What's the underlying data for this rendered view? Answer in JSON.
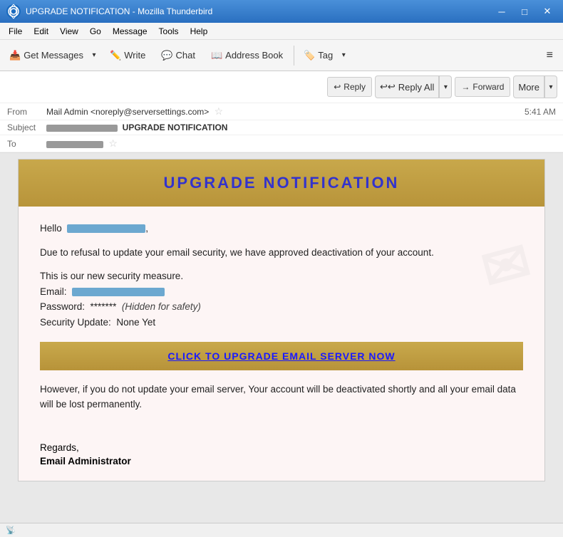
{
  "titleBar": {
    "title": "UPGRADE NOTIFICATION - Mozilla Thunderbird",
    "minimize": "─",
    "maximize": "□",
    "close": "✕"
  },
  "menuBar": {
    "items": [
      "File",
      "Edit",
      "View",
      "Go",
      "Message",
      "Tools",
      "Help"
    ]
  },
  "toolbar": {
    "getMessages": "Get Messages",
    "write": "Write",
    "chat": "Chat",
    "addressBook": "Address Book",
    "tag": "Tag",
    "hamburger": "≡"
  },
  "actionBar": {
    "reply": "Reply",
    "replyAll": "Reply All",
    "forward": "Forward",
    "more": "More"
  },
  "messageHeader": {
    "fromLabel": "From",
    "fromValue": "Mail Admin <noreply@serversettings.com>",
    "subjectLabel": "Subject",
    "subjectPrefix": "██████████████",
    "subjectText": "UPGRADE NOTIFICATION",
    "toLabel": "To",
    "toValue": "██████████",
    "time": "5:41 AM"
  },
  "emailContent": {
    "headerTitle": "UPGRADE  NOTIFICATION",
    "greeting": "Hello",
    "greetingComma": ",",
    "body1": "Due to refusal to update your email security, we have approved deactivation of your account.",
    "body2": "This is our new security measure.",
    "emailLabel": "Email:",
    "passwordLabel": "Password:",
    "passwordValue": "*******",
    "passwordHidden": "(Hidden for safety)",
    "securityLabel": "Security Update:",
    "securityValue": "None Yet",
    "ctaButton": "CLICK TO UPGRADE EMAIL SERVER NOW",
    "body3": "However, if you do not update your email server, Your account will be deactivated shortly and all your email data will be lost permanently.",
    "regards": "Regards,",
    "signature": "Email Administrator"
  },
  "statusBar": {
    "icon": "📡",
    "text": ""
  }
}
